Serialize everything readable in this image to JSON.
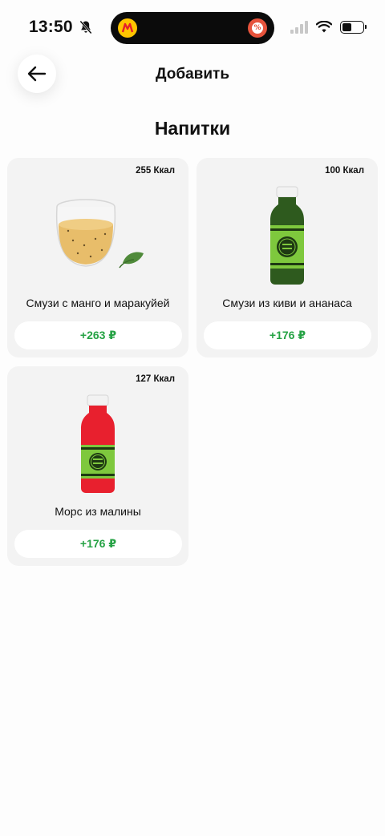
{
  "status_bar": {
    "time": "13:50"
  },
  "header": {
    "title": "Добавить"
  },
  "section": {
    "title": "Напитки"
  },
  "colors": {
    "accent_green": "#25a244",
    "card_background": "#f3f3f3"
  },
  "products": [
    {
      "name": "Смузи с манго и маракуйей",
      "kcal": "255 Ккал",
      "price": "+263 ₽",
      "image_icon": "mango-smoothie-glass-icon"
    },
    {
      "name": "Смузи из киви и ананаса",
      "kcal": "100 Ккал",
      "price": "+176 ₽",
      "image_icon": "green-bottle-icon"
    },
    {
      "name": "Морс из малины",
      "kcal": "127 Ккал",
      "price": "+176 ₽",
      "image_icon": "red-bottle-icon"
    }
  ]
}
